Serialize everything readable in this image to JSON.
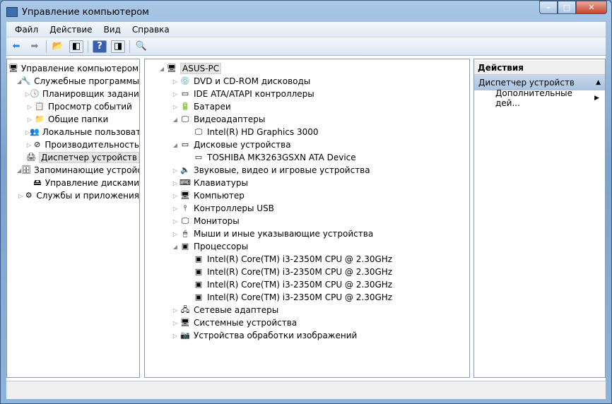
{
  "window": {
    "title": "Управление компьютером",
    "minimize": "–",
    "maximize": "□",
    "close": "✕"
  },
  "menu": [
    "Файл",
    "Действие",
    "Вид",
    "Справка"
  ],
  "left_tree": [
    {
      "label": "Управление компьютером (л",
      "level": 0,
      "arrow": "",
      "icon": "computer-management-icon",
      "glyph": "🖥"
    },
    {
      "label": "Служебные программы",
      "level": 1,
      "arrow": "◢",
      "icon": "tools-icon",
      "glyph": "🔧"
    },
    {
      "label": "Планировщик заданий",
      "level": 2,
      "arrow": "▷",
      "icon": "clock-icon",
      "glyph": "🕓"
    },
    {
      "label": "Просмотр событий",
      "level": 2,
      "arrow": "▷",
      "icon": "event-viewer-icon",
      "glyph": "📋"
    },
    {
      "label": "Общие папки",
      "level": 2,
      "arrow": "▷",
      "icon": "shared-folders-icon",
      "glyph": "📁"
    },
    {
      "label": "Локальные пользовате",
      "level": 2,
      "arrow": "▷",
      "icon": "users-icon",
      "glyph": "👥"
    },
    {
      "label": "Производительность",
      "level": 2,
      "arrow": "▷",
      "icon": "performance-icon",
      "glyph": "⊘"
    },
    {
      "label": "Диспетчер устройств",
      "level": 2,
      "arrow": "",
      "icon": "device-manager-icon",
      "glyph": "🖨",
      "selected": true
    },
    {
      "label": "Запоминающие устройст",
      "level": 1,
      "arrow": "◢",
      "icon": "storage-icon",
      "glyph": "🗄"
    },
    {
      "label": "Управление дисками",
      "level": 2,
      "arrow": "",
      "icon": "disk-management-icon",
      "glyph": "🖴"
    },
    {
      "label": "Службы и приложения",
      "level": 1,
      "arrow": "▷",
      "icon": "services-icon",
      "glyph": "⚙"
    }
  ],
  "device_tree": [
    {
      "label": "ASUS-PC",
      "level": 0,
      "arrow": "◢",
      "icon": "computer-icon",
      "glyph": "🖥",
      "selected": true
    },
    {
      "label": "DVD и CD-ROM дисководы",
      "level": 1,
      "arrow": "▷",
      "icon": "dvd-icon",
      "glyph": "💿"
    },
    {
      "label": "IDE ATA/ATAPI контроллеры",
      "level": 1,
      "arrow": "▷",
      "icon": "ide-icon",
      "glyph": "▭"
    },
    {
      "label": "Батареи",
      "level": 1,
      "arrow": "▷",
      "icon": "battery-icon",
      "glyph": "🔋"
    },
    {
      "label": "Видеоадаптеры",
      "level": 1,
      "arrow": "◢",
      "icon": "display-adapter-icon",
      "glyph": "🖵"
    },
    {
      "label": "Intel(R) HD Graphics 3000",
      "level": 2,
      "arrow": "",
      "icon": "display-adapter-icon",
      "glyph": "🖵"
    },
    {
      "label": "Дисковые устройства",
      "level": 1,
      "arrow": "◢",
      "icon": "disk-icon",
      "glyph": "▭"
    },
    {
      "label": "TOSHIBA MK3263GSXN ATA Device",
      "level": 2,
      "arrow": "",
      "icon": "disk-icon",
      "glyph": "▭"
    },
    {
      "label": "Звуковые, видео и игровые устройства",
      "level": 1,
      "arrow": "▷",
      "icon": "sound-icon",
      "glyph": "🔈"
    },
    {
      "label": "Клавиатуры",
      "level": 1,
      "arrow": "▷",
      "icon": "keyboard-icon",
      "glyph": "⌨"
    },
    {
      "label": "Компьютер",
      "level": 1,
      "arrow": "▷",
      "icon": "computer-icon",
      "glyph": "🖥"
    },
    {
      "label": "Контроллеры USB",
      "level": 1,
      "arrow": "▷",
      "icon": "usb-icon",
      "glyph": "⫯"
    },
    {
      "label": "Мониторы",
      "level": 1,
      "arrow": "▷",
      "icon": "monitor-icon",
      "glyph": "🖵"
    },
    {
      "label": "Мыши и иные указывающие устройства",
      "level": 1,
      "arrow": "▷",
      "icon": "mouse-icon",
      "glyph": "🖱"
    },
    {
      "label": "Процессоры",
      "level": 1,
      "arrow": "◢",
      "icon": "processor-icon",
      "glyph": "▣"
    },
    {
      "label": "Intel(R) Core(TM) i3-2350M CPU @ 2.30GHz",
      "level": 2,
      "arrow": "",
      "icon": "processor-icon",
      "glyph": "▣"
    },
    {
      "label": "Intel(R) Core(TM) i3-2350M CPU @ 2.30GHz",
      "level": 2,
      "arrow": "",
      "icon": "processor-icon",
      "glyph": "▣"
    },
    {
      "label": "Intel(R) Core(TM) i3-2350M CPU @ 2.30GHz",
      "level": 2,
      "arrow": "",
      "icon": "processor-icon",
      "glyph": "▣"
    },
    {
      "label": "Intel(R) Core(TM) i3-2350M CPU @ 2.30GHz",
      "level": 2,
      "arrow": "",
      "icon": "processor-icon",
      "glyph": "▣"
    },
    {
      "label": "Сетевые адаптеры",
      "level": 1,
      "arrow": "▷",
      "icon": "network-icon",
      "glyph": "🖧"
    },
    {
      "label": "Системные устройства",
      "level": 1,
      "arrow": "▷",
      "icon": "system-devices-icon",
      "glyph": "🖥"
    },
    {
      "label": "Устройства обработки изображений",
      "level": 1,
      "arrow": "▷",
      "icon": "camera-icon",
      "glyph": "📷"
    }
  ],
  "actions": {
    "header": "Действия",
    "section": "Диспетчер устройств",
    "section_arrow": "▲",
    "more": "Дополнительные дей...",
    "more_arrow": "▶"
  }
}
